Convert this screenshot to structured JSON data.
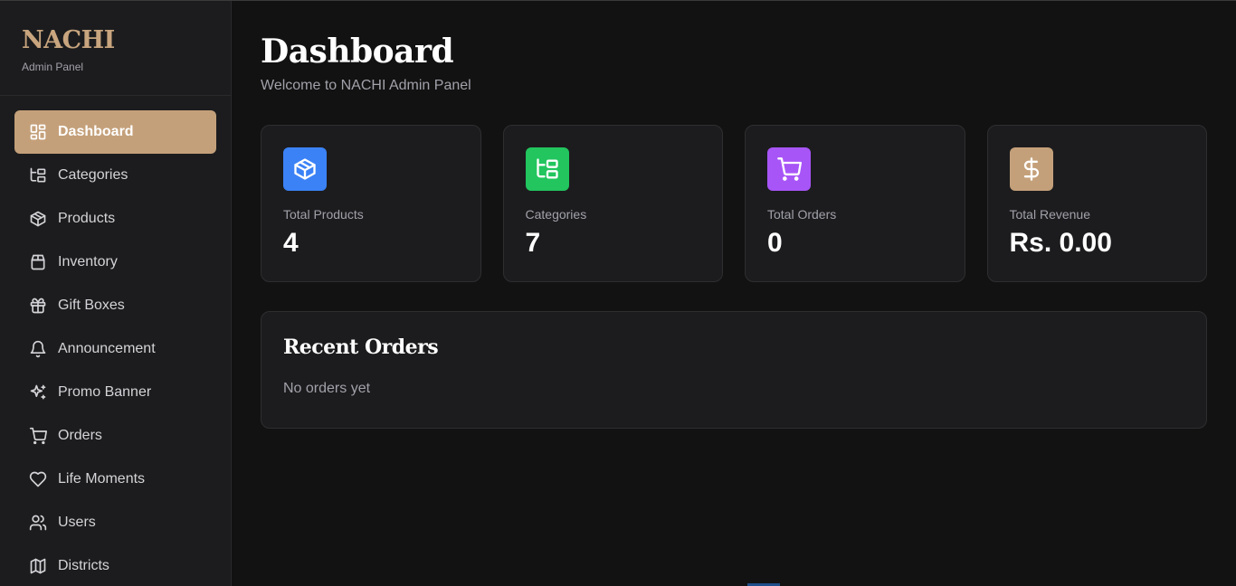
{
  "brand": {
    "name": "NACHI",
    "subtitle": "Admin Panel"
  },
  "sidebar": {
    "items": [
      {
        "label": "Dashboard",
        "icon": "dashboard-icon",
        "active": true
      },
      {
        "label": "Categories",
        "icon": "folder-tree-icon"
      },
      {
        "label": "Products",
        "icon": "package-icon"
      },
      {
        "label": "Inventory",
        "icon": "archive-icon"
      },
      {
        "label": "Gift Boxes",
        "icon": "gift-icon"
      },
      {
        "label": "Announcement",
        "icon": "bell-icon"
      },
      {
        "label": "Promo Banner",
        "icon": "sparkles-icon"
      },
      {
        "label": "Orders",
        "icon": "cart-icon"
      },
      {
        "label": "Life Moments",
        "icon": "heart-icon"
      },
      {
        "label": "Users",
        "icon": "users-icon"
      },
      {
        "label": "Districts",
        "icon": "map-icon"
      }
    ]
  },
  "header": {
    "title": "Dashboard",
    "subtitle": "Welcome to NACHI Admin Panel"
  },
  "stats": [
    {
      "label": "Total Products",
      "value": "4",
      "icon": "package-icon",
      "color": "#3b82f6"
    },
    {
      "label": "Categories",
      "value": "7",
      "icon": "folder-tree-icon",
      "color": "#22c55e"
    },
    {
      "label": "Total Orders",
      "value": "0",
      "icon": "cart-icon",
      "color": "#a855f7"
    },
    {
      "label": "Total Revenue",
      "value": "Rs. 0.00",
      "icon": "dollar-icon",
      "color": "#c4a07a"
    }
  ],
  "recent_orders": {
    "title": "Recent Orders",
    "empty_text": "No orders yet"
  },
  "colors": {
    "accent": "#c4a07a",
    "background": "#121212",
    "panel": "#1c1c1e"
  }
}
